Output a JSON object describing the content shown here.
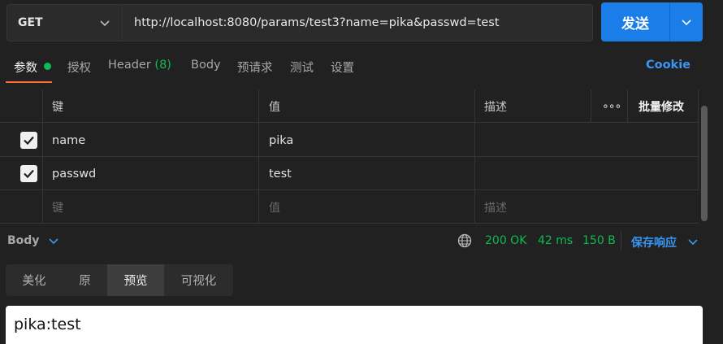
{
  "request": {
    "method": "GET",
    "url": "http://localhost:8080/params/test3?name=pika&passwd=test",
    "send_label": "发送"
  },
  "tabs": {
    "items": [
      {
        "label": "参数",
        "active": true
      },
      {
        "label": "授权"
      },
      {
        "label": "Header",
        "count": "(8)"
      },
      {
        "label": "Body"
      },
      {
        "label": "预请求"
      },
      {
        "label": "测试"
      },
      {
        "label": "设置"
      }
    ],
    "cookie_label": "Cookie"
  },
  "params_table": {
    "headers": {
      "key": "键",
      "value": "值",
      "description": "描述",
      "more": "∘∘∘",
      "bulk_edit": "批量修改"
    },
    "rows": [
      {
        "checked": true,
        "key": "name",
        "value": "pika",
        "description": ""
      },
      {
        "checked": true,
        "key": "passwd",
        "value": "test",
        "description": ""
      }
    ],
    "placeholders": {
      "key": "键",
      "value": "值",
      "description": "描述"
    }
  },
  "response": {
    "section_label": "Body",
    "status": "200 OK",
    "time": "42 ms",
    "size": "150 B",
    "save_label": "保存响应",
    "view_tabs": [
      {
        "label": "美化"
      },
      {
        "label": "原"
      },
      {
        "label": "预览",
        "active": true
      },
      {
        "label": "可视化"
      }
    ],
    "preview_text": "pika:test"
  },
  "colors": {
    "accent": "#1a7de8",
    "status_green": "#0cbb52",
    "active_tab_underline": "#ff6c37",
    "link_blue": "#3a96f5",
    "background": "#212121"
  }
}
